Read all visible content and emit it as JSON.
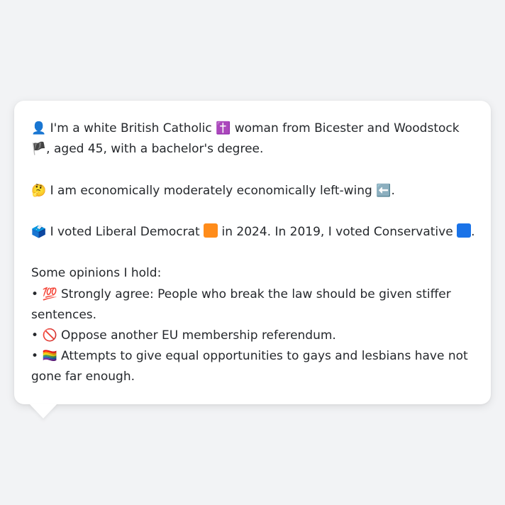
{
  "card": {
    "intro": {
      "icon": "👤",
      "text_a": "I'm a white British Catholic",
      "icon_religion": "✝️",
      "text_b": "woman from Bicester and Woodstock",
      "icon_flag": "🏴",
      "text_c": ", aged 45, with a bachelor's degree."
    },
    "economics": {
      "icon": "🤔",
      "text": "I am economically moderately economically left-wing",
      "icon_arrow": "⬅️",
      "text_end": "."
    },
    "voting": {
      "icon": "🗳️",
      "text_a": "I voted Liberal Democrat",
      "party_2024_color": "#ff8c1a",
      "text_b": "in 2024. In 2019, I voted Conservative",
      "party_2019_color": "#1a73e8",
      "text_end": "."
    },
    "opinions": {
      "heading": "Some opinions I hold:",
      "bullet": "•",
      "items": [
        {
          "icon": "💯",
          "text": "Strongly agree: People who break the law should be given stiffer sentences."
        },
        {
          "icon": "🚫",
          "text": "Oppose another EU membership referendum."
        },
        {
          "icon": "🏳️‍🌈",
          "text": "Attempts to give equal opportunities to gays and lesbians have not gone far enough."
        }
      ]
    }
  }
}
